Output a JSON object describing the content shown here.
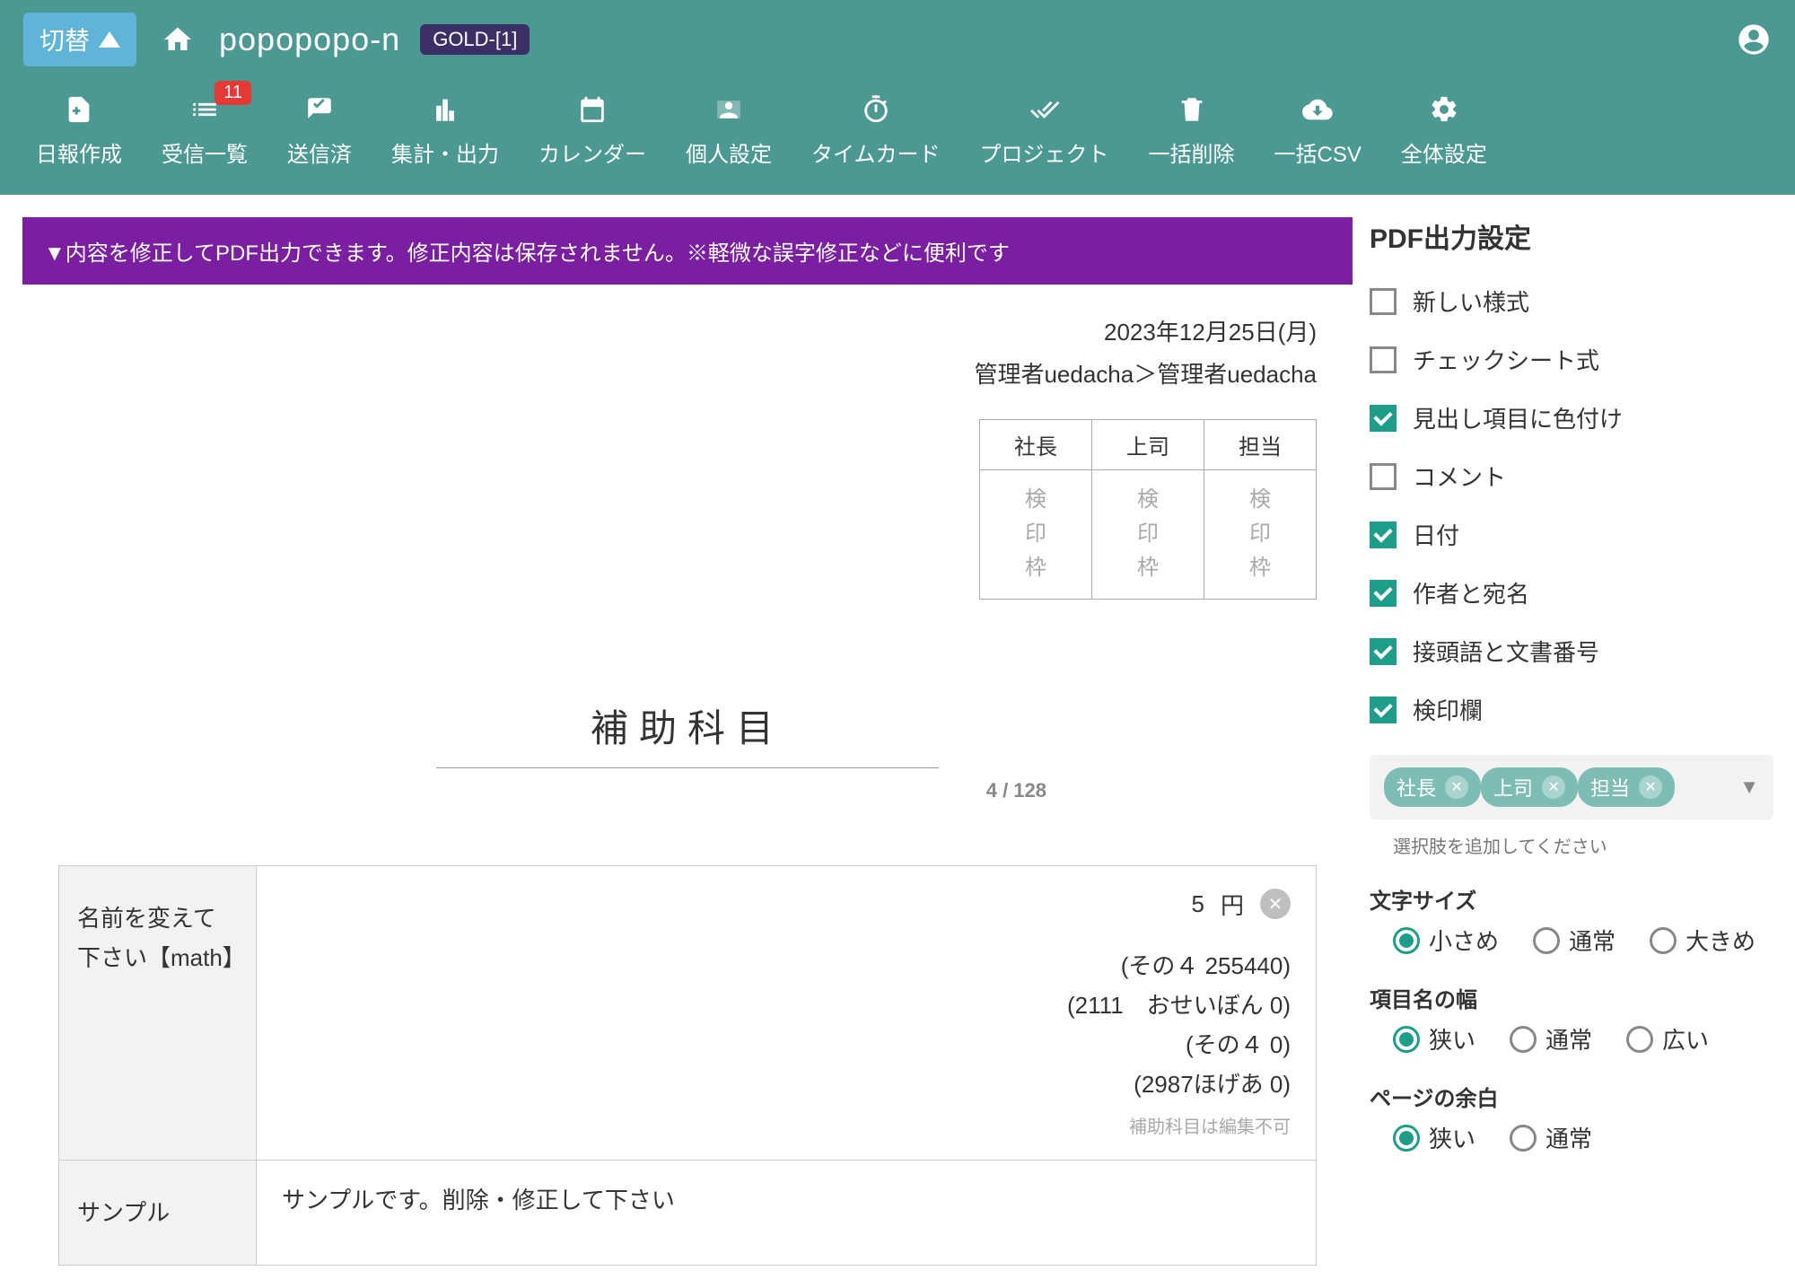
{
  "topbar": {
    "switch_label": "切替",
    "brand": "popopopo-n",
    "plan_badge": "GOLD-[1]"
  },
  "nav": {
    "items": [
      {
        "label": "日報作成"
      },
      {
        "label": "受信一覧",
        "badge": "11"
      },
      {
        "label": "送信済"
      },
      {
        "label": "集計・出力"
      },
      {
        "label": "カレンダー"
      },
      {
        "label": "個人設定"
      },
      {
        "label": "タイムカード"
      },
      {
        "label": "プロジェクト"
      },
      {
        "label": "一括削除"
      },
      {
        "label": "一括CSV"
      },
      {
        "label": "全体設定"
      }
    ]
  },
  "banner": "▼内容を修正してPDF出力できます。修正内容は保存されません。※軽微な誤字修正などに便利です",
  "doc": {
    "date": "2023年12月25日(月)",
    "routing": "管理者uedacha＞管理者uedacha",
    "stamp_headers": [
      "社長",
      "上司",
      "担当"
    ],
    "stamp_cell": "検\n印\n枠",
    "title": "補助科目",
    "counter": "4 / 128",
    "rows": [
      {
        "label": "名前を変えて下さい【math】",
        "top_value": "5",
        "top_unit": "円",
        "lines": [
          "(その４ 255440)",
          "(2111　おせいぼん 0)",
          "(その４ 0)",
          "(2987ほげあ 0)"
        ],
        "note": "補助科目は編集不可"
      },
      {
        "label": "サンプル",
        "text": "サンプルです。削除・修正して下さい"
      }
    ]
  },
  "settings": {
    "heading": "PDF出力設定",
    "checks": [
      {
        "label": "新しい様式",
        "checked": false
      },
      {
        "label": "チェックシート式",
        "checked": false
      },
      {
        "label": "見出し項目に色付け",
        "checked": true
      },
      {
        "label": "コメント",
        "checked": false
      },
      {
        "label": "日付",
        "checked": true
      },
      {
        "label": "作者と宛名",
        "checked": true
      },
      {
        "label": "接頭語と文書番号",
        "checked": true
      },
      {
        "label": "検印欄",
        "checked": true
      }
    ],
    "chips": [
      "社長",
      "上司",
      "担当"
    ],
    "chips_hint": "選択肢を追加してください",
    "font_size": {
      "label": "文字サイズ",
      "options": [
        "小さめ",
        "通常",
        "大きめ"
      ],
      "selected": 0
    },
    "col_width": {
      "label": "項目名の幅",
      "options": [
        "狭い",
        "通常",
        "広い"
      ],
      "selected": 0
    },
    "page_margin": {
      "label": "ページの余白",
      "options": [
        "狭い",
        "通常"
      ],
      "selected": 0
    }
  }
}
